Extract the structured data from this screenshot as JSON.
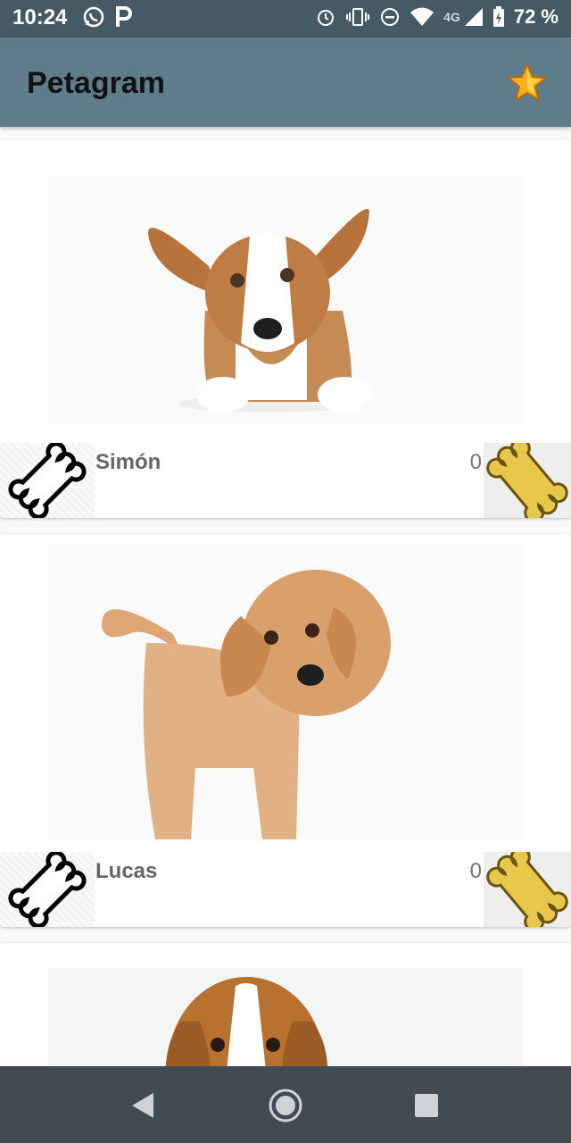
{
  "status_bar": {
    "time": "10:24",
    "network": "4G",
    "battery": "72 %",
    "icons": [
      "whatsapp-icon",
      "parking-icon",
      "alarm-icon",
      "vibrate-icon",
      "dnd-icon",
      "wifi-icon",
      "signal-icon",
      "battery-icon"
    ]
  },
  "app_bar": {
    "title": "Petagram",
    "action_icon": "star-icon"
  },
  "pets": [
    {
      "name": "Simón",
      "likes": "0",
      "photo": "corgi-puppy"
    },
    {
      "name": "Lucas",
      "likes": "0",
      "photo": "golden-retriever-puppy"
    },
    {
      "name": "",
      "likes": "",
      "photo": "beagle-puppy"
    }
  ],
  "nav_bar": {
    "icons": [
      "back-icon",
      "home-icon",
      "recents-icon"
    ]
  },
  "colors": {
    "status_bar": "#455a64",
    "app_bar": "#5f7c8a",
    "nav_bar": "#424b53",
    "bone_gold": "#e7c84a"
  }
}
